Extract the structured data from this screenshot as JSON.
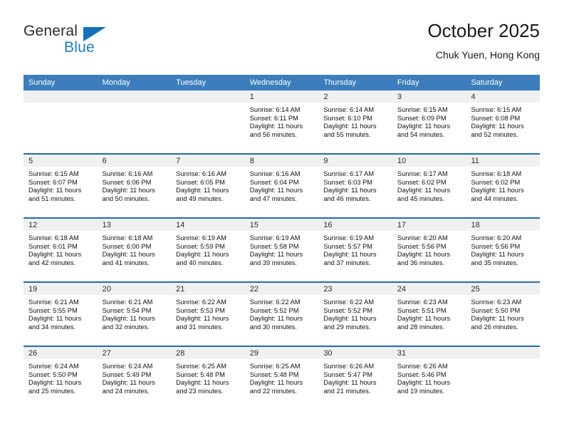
{
  "brand": {
    "name_top": "General",
    "name_bottom": "Blue",
    "triangle_color": "#1271b8",
    "blue_color": "#1b7fd0"
  },
  "header": {
    "title": "October 2025",
    "subtitle": "Chuk Yuen, Hong Kong"
  },
  "theme": {
    "header_row_bg": "#3b7dbd",
    "week_separator": "#1f6cb0",
    "day_band_bg": "#f0f0f0"
  },
  "weekdays": [
    "Sunday",
    "Monday",
    "Tuesday",
    "Wednesday",
    "Thursday",
    "Friday",
    "Saturday"
  ],
  "weeks": [
    {
      "days": [
        {
          "number": "",
          "line1": "",
          "line2": "",
          "line3": "",
          "line4": ""
        },
        {
          "number": "",
          "line1": "",
          "line2": "",
          "line3": "",
          "line4": ""
        },
        {
          "number": "",
          "line1": "",
          "line2": "",
          "line3": "",
          "line4": ""
        },
        {
          "number": "1",
          "line1": "Sunrise: 6:14 AM",
          "line2": "Sunset: 6:11 PM",
          "line3": "Daylight: 11 hours",
          "line4": "and 56 minutes."
        },
        {
          "number": "2",
          "line1": "Sunrise: 6:14 AM",
          "line2": "Sunset: 6:10 PM",
          "line3": "Daylight: 11 hours",
          "line4": "and 55 minutes."
        },
        {
          "number": "3",
          "line1": "Sunrise: 6:15 AM",
          "line2": "Sunset: 6:09 PM",
          "line3": "Daylight: 11 hours",
          "line4": "and 54 minutes."
        },
        {
          "number": "4",
          "line1": "Sunrise: 6:15 AM",
          "line2": "Sunset: 6:08 PM",
          "line3": "Daylight: 11 hours",
          "line4": "and 52 minutes."
        }
      ]
    },
    {
      "days": [
        {
          "number": "5",
          "line1": "Sunrise: 6:15 AM",
          "line2": "Sunset: 6:07 PM",
          "line3": "Daylight: 11 hours",
          "line4": "and 51 minutes."
        },
        {
          "number": "6",
          "line1": "Sunrise: 6:16 AM",
          "line2": "Sunset: 6:06 PM",
          "line3": "Daylight: 11 hours",
          "line4": "and 50 minutes."
        },
        {
          "number": "7",
          "line1": "Sunrise: 6:16 AM",
          "line2": "Sunset: 6:05 PM",
          "line3": "Daylight: 11 hours",
          "line4": "and 49 minutes."
        },
        {
          "number": "8",
          "line1": "Sunrise: 6:16 AM",
          "line2": "Sunset: 6:04 PM",
          "line3": "Daylight: 11 hours",
          "line4": "and 47 minutes."
        },
        {
          "number": "9",
          "line1": "Sunrise: 6:17 AM",
          "line2": "Sunset: 6:03 PM",
          "line3": "Daylight: 11 hours",
          "line4": "and 46 minutes."
        },
        {
          "number": "10",
          "line1": "Sunrise: 6:17 AM",
          "line2": "Sunset: 6:02 PM",
          "line3": "Daylight: 11 hours",
          "line4": "and 45 minutes."
        },
        {
          "number": "11",
          "line1": "Sunrise: 6:18 AM",
          "line2": "Sunset: 6:02 PM",
          "line3": "Daylight: 11 hours",
          "line4": "and 44 minutes."
        }
      ]
    },
    {
      "days": [
        {
          "number": "12",
          "line1": "Sunrise: 6:18 AM",
          "line2": "Sunset: 6:01 PM",
          "line3": "Daylight: 11 hours",
          "line4": "and 42 minutes."
        },
        {
          "number": "13",
          "line1": "Sunrise: 6:18 AM",
          "line2": "Sunset: 6:00 PM",
          "line3": "Daylight: 11 hours",
          "line4": "and 41 minutes."
        },
        {
          "number": "14",
          "line1": "Sunrise: 6:19 AM",
          "line2": "Sunset: 5:59 PM",
          "line3": "Daylight: 11 hours",
          "line4": "and 40 minutes."
        },
        {
          "number": "15",
          "line1": "Sunrise: 6:19 AM",
          "line2": "Sunset: 5:58 PM",
          "line3": "Daylight: 11 hours",
          "line4": "and 39 minutes."
        },
        {
          "number": "16",
          "line1": "Sunrise: 6:19 AM",
          "line2": "Sunset: 5:57 PM",
          "line3": "Daylight: 11 hours",
          "line4": "and 37 minutes."
        },
        {
          "number": "17",
          "line1": "Sunrise: 6:20 AM",
          "line2": "Sunset: 5:56 PM",
          "line3": "Daylight: 11 hours",
          "line4": "and 36 minutes."
        },
        {
          "number": "18",
          "line1": "Sunrise: 6:20 AM",
          "line2": "Sunset: 5:56 PM",
          "line3": "Daylight: 11 hours",
          "line4": "and 35 minutes."
        }
      ]
    },
    {
      "days": [
        {
          "number": "19",
          "line1": "Sunrise: 6:21 AM",
          "line2": "Sunset: 5:55 PM",
          "line3": "Daylight: 11 hours",
          "line4": "and 34 minutes."
        },
        {
          "number": "20",
          "line1": "Sunrise: 6:21 AM",
          "line2": "Sunset: 5:54 PM",
          "line3": "Daylight: 11 hours",
          "line4": "and 32 minutes."
        },
        {
          "number": "21",
          "line1": "Sunrise: 6:22 AM",
          "line2": "Sunset: 5:53 PM",
          "line3": "Daylight: 11 hours",
          "line4": "and 31 minutes."
        },
        {
          "number": "22",
          "line1": "Sunrise: 6:22 AM",
          "line2": "Sunset: 5:52 PM",
          "line3": "Daylight: 11 hours",
          "line4": "and 30 minutes."
        },
        {
          "number": "23",
          "line1": "Sunrise: 6:22 AM",
          "line2": "Sunset: 5:52 PM",
          "line3": "Daylight: 11 hours",
          "line4": "and 29 minutes."
        },
        {
          "number": "24",
          "line1": "Sunrise: 6:23 AM",
          "line2": "Sunset: 5:51 PM",
          "line3": "Daylight: 11 hours",
          "line4": "and 28 minutes."
        },
        {
          "number": "25",
          "line1": "Sunrise: 6:23 AM",
          "line2": "Sunset: 5:50 PM",
          "line3": "Daylight: 11 hours",
          "line4": "and 26 minutes."
        }
      ]
    },
    {
      "days": [
        {
          "number": "26",
          "line1": "Sunrise: 6:24 AM",
          "line2": "Sunset: 5:50 PM",
          "line3": "Daylight: 11 hours",
          "line4": "and 25 minutes."
        },
        {
          "number": "27",
          "line1": "Sunrise: 6:24 AM",
          "line2": "Sunset: 5:49 PM",
          "line3": "Daylight: 11 hours",
          "line4": "and 24 minutes."
        },
        {
          "number": "28",
          "line1": "Sunrise: 6:25 AM",
          "line2": "Sunset: 5:48 PM",
          "line3": "Daylight: 11 hours",
          "line4": "and 23 minutes."
        },
        {
          "number": "29",
          "line1": "Sunrise: 6:25 AM",
          "line2": "Sunset: 5:48 PM",
          "line3": "Daylight: 11 hours",
          "line4": "and 22 minutes."
        },
        {
          "number": "30",
          "line1": "Sunrise: 6:26 AM",
          "line2": "Sunset: 5:47 PM",
          "line3": "Daylight: 11 hours",
          "line4": "and 21 minutes."
        },
        {
          "number": "31",
          "line1": "Sunrise: 6:26 AM",
          "line2": "Sunset: 5:46 PM",
          "line3": "Daylight: 11 hours",
          "line4": "and 19 minutes."
        },
        {
          "number": "",
          "line1": "",
          "line2": "",
          "line3": "",
          "line4": ""
        }
      ]
    }
  ]
}
